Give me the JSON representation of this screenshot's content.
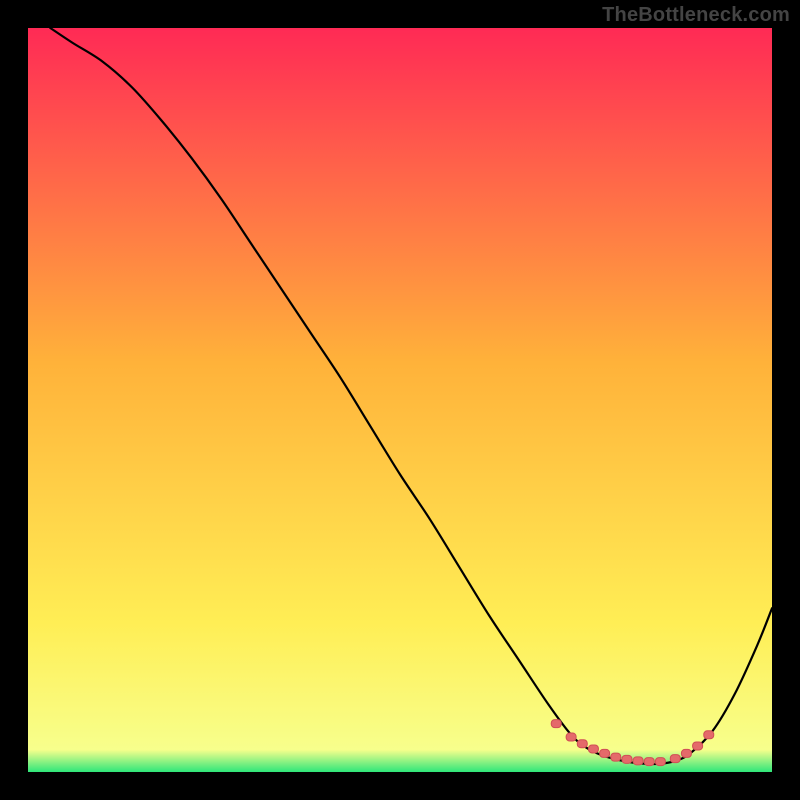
{
  "watermark": "TheBottleneck.com",
  "colors": {
    "background": "#000000",
    "gradient_top": "#ff2a55",
    "gradient_mid": "#ffb23a",
    "gradient_low": "#ffee55",
    "gradient_bottom": "#2fe67a",
    "curve": "#000000",
    "marker_fill": "#e46a6a",
    "marker_stroke": "#d04f55"
  },
  "chart_data": {
    "type": "line",
    "title": "",
    "xlabel": "",
    "ylabel": "",
    "xlim": [
      0,
      100
    ],
    "ylim": [
      0,
      100
    ],
    "series": [
      {
        "name": "bottleneck-curve",
        "x": [
          3,
          6,
          10,
          14,
          18,
          22,
          26,
          30,
          34,
          38,
          42,
          46,
          50,
          54,
          58,
          62,
          66,
          70,
          73,
          75,
          77,
          79,
          81,
          83,
          85,
          87,
          89,
          92,
          95,
          98,
          100
        ],
        "y": [
          100,
          98,
          95.5,
          92,
          87.5,
          82.5,
          77,
          71,
          65,
          59,
          53,
          46.5,
          40,
          34,
          27.5,
          21,
          15,
          9,
          5,
          3.3,
          2.3,
          1.7,
          1.3,
          1.1,
          1.1,
          1.5,
          2.5,
          5.5,
          10.5,
          17,
          22
        ]
      }
    ],
    "markers": {
      "name": "highlight-band",
      "x": [
        71,
        73,
        74.5,
        76,
        77.5,
        79,
        80.5,
        82,
        83.5,
        85,
        87,
        88.5,
        90,
        91.5
      ],
      "y": [
        6.5,
        4.7,
        3.8,
        3.1,
        2.5,
        2.0,
        1.7,
        1.5,
        1.4,
        1.4,
        1.8,
        2.5,
        3.5,
        5.0
      ]
    }
  }
}
